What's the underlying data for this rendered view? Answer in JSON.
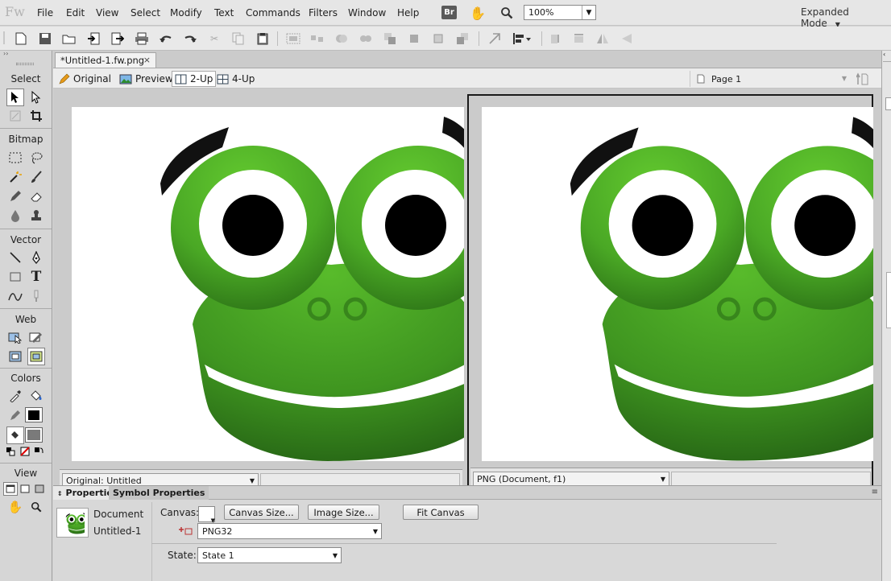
{
  "app": {
    "logo_text": "Fw",
    "menus": [
      "File",
      "Edit",
      "View",
      "Select",
      "Modify",
      "Text",
      "Commands",
      "Filters",
      "Window",
      "Help"
    ],
    "bridge_icon_text": "Br",
    "zoom_value": "100%",
    "workspace_mode": "Expanded Mode"
  },
  "document": {
    "tab_title": "*Untitled-1.fw.png",
    "close_glyph": "×",
    "view_modes": [
      "Original",
      "Preview",
      "2-Up",
      "4-Up"
    ],
    "active_view": "2-Up",
    "page": "Page 1"
  },
  "panes": {
    "left_label": "Original: Untitled",
    "right_label": "PNG (Document, f1)"
  },
  "tools_panel": {
    "sections": [
      "Select",
      "Bitmap",
      "Vector",
      "Web",
      "Colors",
      "View"
    ]
  },
  "properties": {
    "tabs": [
      "Properties",
      "Symbol Properties"
    ],
    "doc_label": "Document",
    "doc_name": "Untitled-1",
    "canvas_label": "Canvas:",
    "canvas_size_btn": "Canvas Size...",
    "image_size_btn": "Image Size...",
    "fit_canvas_btn": "Fit Canvas",
    "format": "PNG32",
    "state_label": "State:",
    "state_value": "State 1"
  },
  "colors": {
    "frog_green_light": "#5cc42d",
    "frog_green_dark": "#2f7a18",
    "stroke_color": "#000000",
    "fill_color": "#7a7a7a"
  }
}
